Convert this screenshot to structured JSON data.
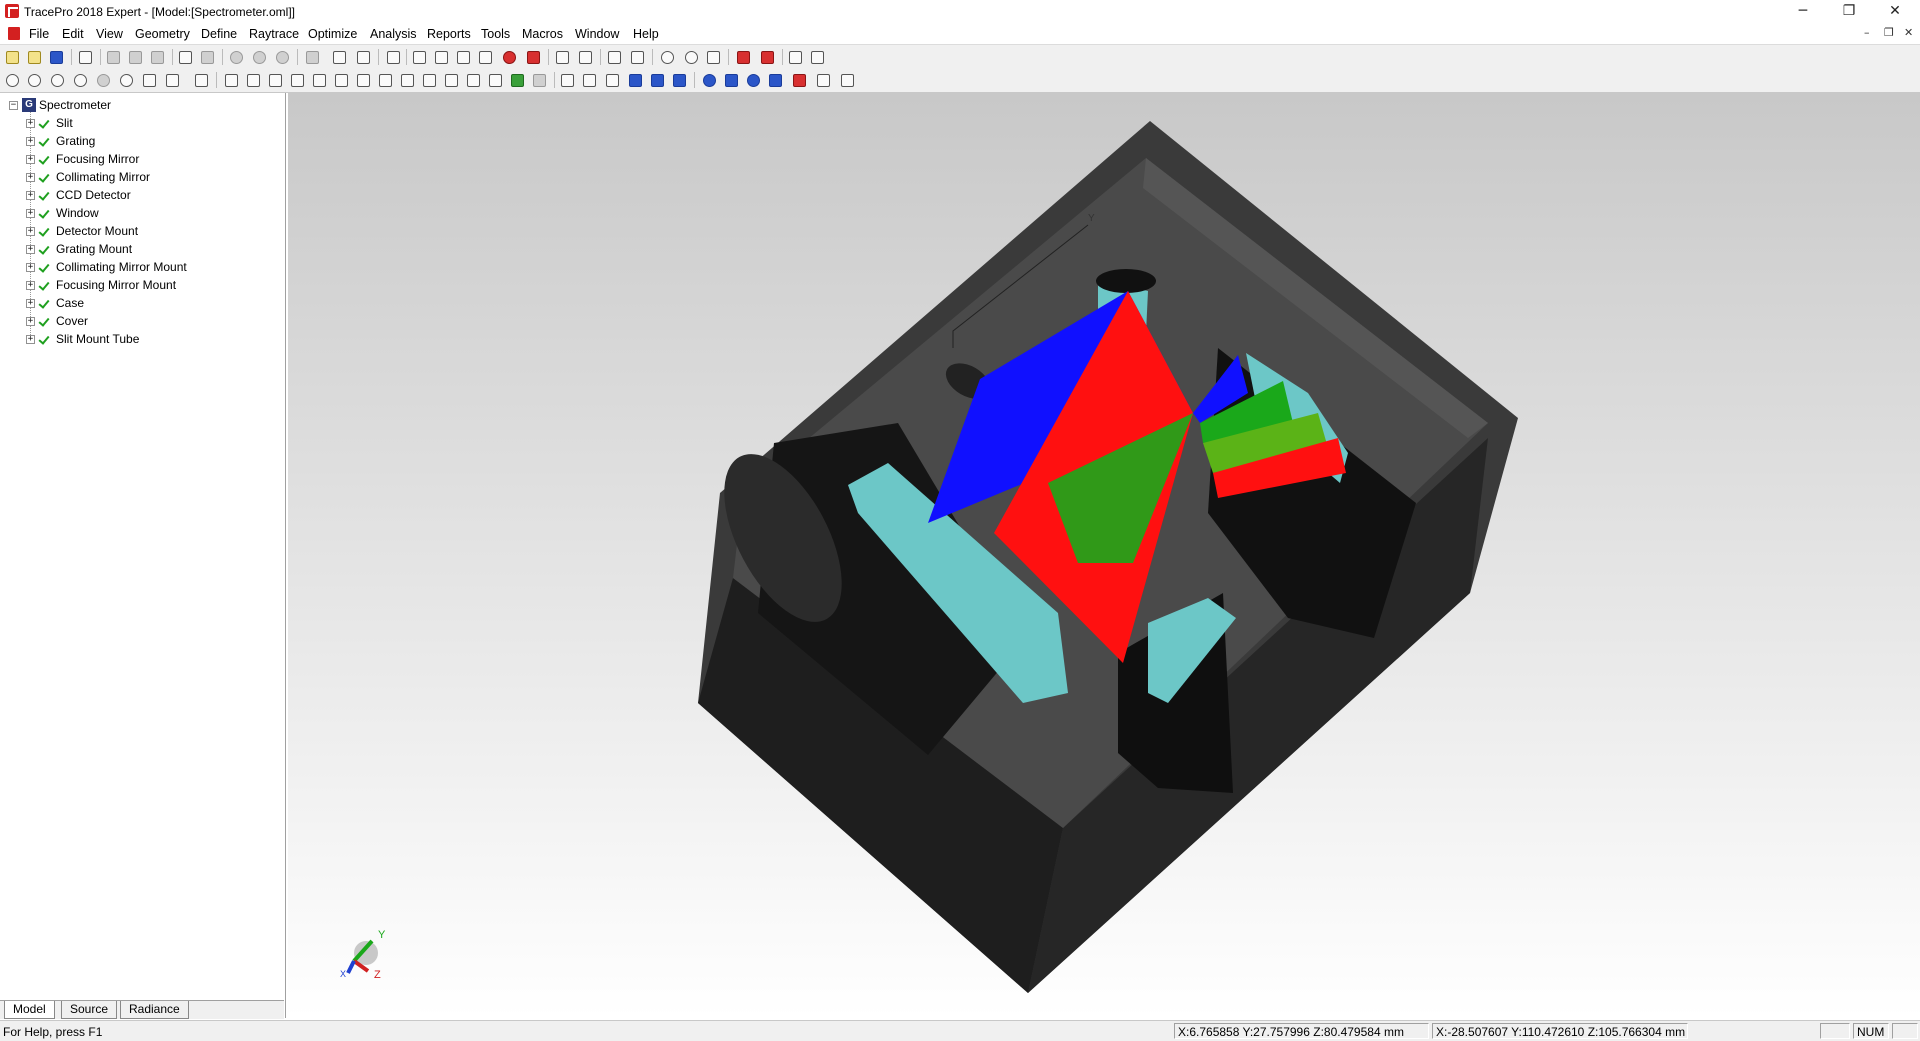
{
  "window": {
    "title": "TracePro 2018 Expert - [Model:[Spectrometer.oml]]",
    "minimize_glyph": "─",
    "restore_glyph": "❐",
    "close_glyph": "✕"
  },
  "menu": {
    "items": [
      "File",
      "Edit",
      "View",
      "Geometry",
      "Define",
      "Raytrace",
      "Optimize",
      "Analysis",
      "Reports",
      "Tools",
      "Macros",
      "Window",
      "Help"
    ],
    "mdi_minimize": "–",
    "mdi_restore": "❐",
    "mdi_close": "✕"
  },
  "tree": {
    "root": "Spectrometer",
    "root_badge": "G",
    "items": [
      "Slit",
      "Grating",
      "Focusing Mirror",
      "Collimating Mirror",
      "CCD Detector",
      "Window",
      "Detector Mount",
      "Grating Mount",
      "Collimating Mirror Mount",
      "Focusing Mirror Mount",
      "Case",
      "Cover",
      "Slit Mount Tube"
    ]
  },
  "tabs": [
    "Model",
    "Source",
    "Radiance"
  ],
  "viewport": {
    "axis_labels": {
      "x": "X",
      "y": "Y",
      "z": "Z"
    },
    "model_axis_label": "Y"
  },
  "status": {
    "help": "For Help, press F1",
    "coord1": "X:6.765858 Y:27.757996 Z:80.479584 mm",
    "coord2": "X:-28.507607 Y:110.472610 Z:105.766304 mm",
    "num": "NUM"
  },
  "colors": {
    "ray_blue": "#1010ff",
    "ray_red": "#ff1010",
    "ray_green": "#1aa81a",
    "mount_cyan": "#6cc7c7",
    "case_dark": "#2e2e2e"
  }
}
